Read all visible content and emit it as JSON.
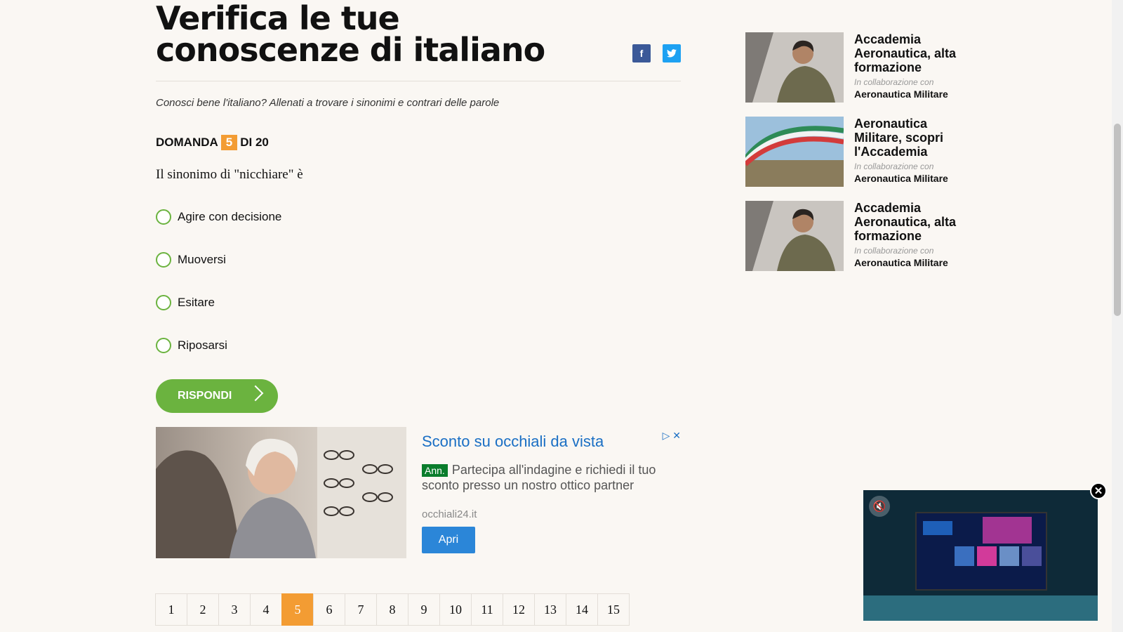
{
  "quiz": {
    "title": "Verifica le tue conoscenze di italiano",
    "intro": "Conosci bene l'italiano? Allenati a trovare i sinonimi e contrari delle parole",
    "question_label": "DOMANDA",
    "question_number": "5",
    "question_of": "DI 20",
    "question_text": "Il sinonimo di \"nicchiare\" è",
    "options": [
      "Agire con decisione",
      "Muoversi",
      "Esitare",
      "Riposarsi"
    ],
    "submit_label": "RISPONDI"
  },
  "share": {
    "facebook_icon": "f",
    "twitter_icon": "t"
  },
  "ad": {
    "title": "Sconto su occhiali da vista",
    "badge": "Ann.",
    "text": "Partecipa all'indagine e richiedi il tuo sconto presso un nostro ottico partner",
    "url": "occhiali24.it",
    "button": "Apri",
    "adchoices_icon": "▷",
    "close_icon": "✕"
  },
  "pagination": {
    "pages": [
      "1",
      "2",
      "3",
      "4",
      "5",
      "6",
      "7",
      "8",
      "9",
      "10",
      "11",
      "12",
      "13",
      "14",
      "15"
    ],
    "current": "5"
  },
  "sidebar": {
    "cards": [
      {
        "title": "Accademia Aeronautica, alta formazione",
        "collab": "In collaborazione con",
        "sponsor": "Aeronautica Militare"
      },
      {
        "title": "Aeronautica Militare, scopri l'Accademia",
        "collab": "In collaborazione con",
        "sponsor": "Aeronautica Militare"
      },
      {
        "title": "Accademia Aeronautica, alta formazione",
        "collab": "In collaborazione con",
        "sponsor": "Aeronautica Militare"
      }
    ]
  },
  "video": {
    "mute_icon": "🔇",
    "close_icon": "✕"
  },
  "colors": {
    "accent_green": "#6bb33f",
    "accent_orange": "#f39c33",
    "link_blue": "#1a6fc4"
  }
}
